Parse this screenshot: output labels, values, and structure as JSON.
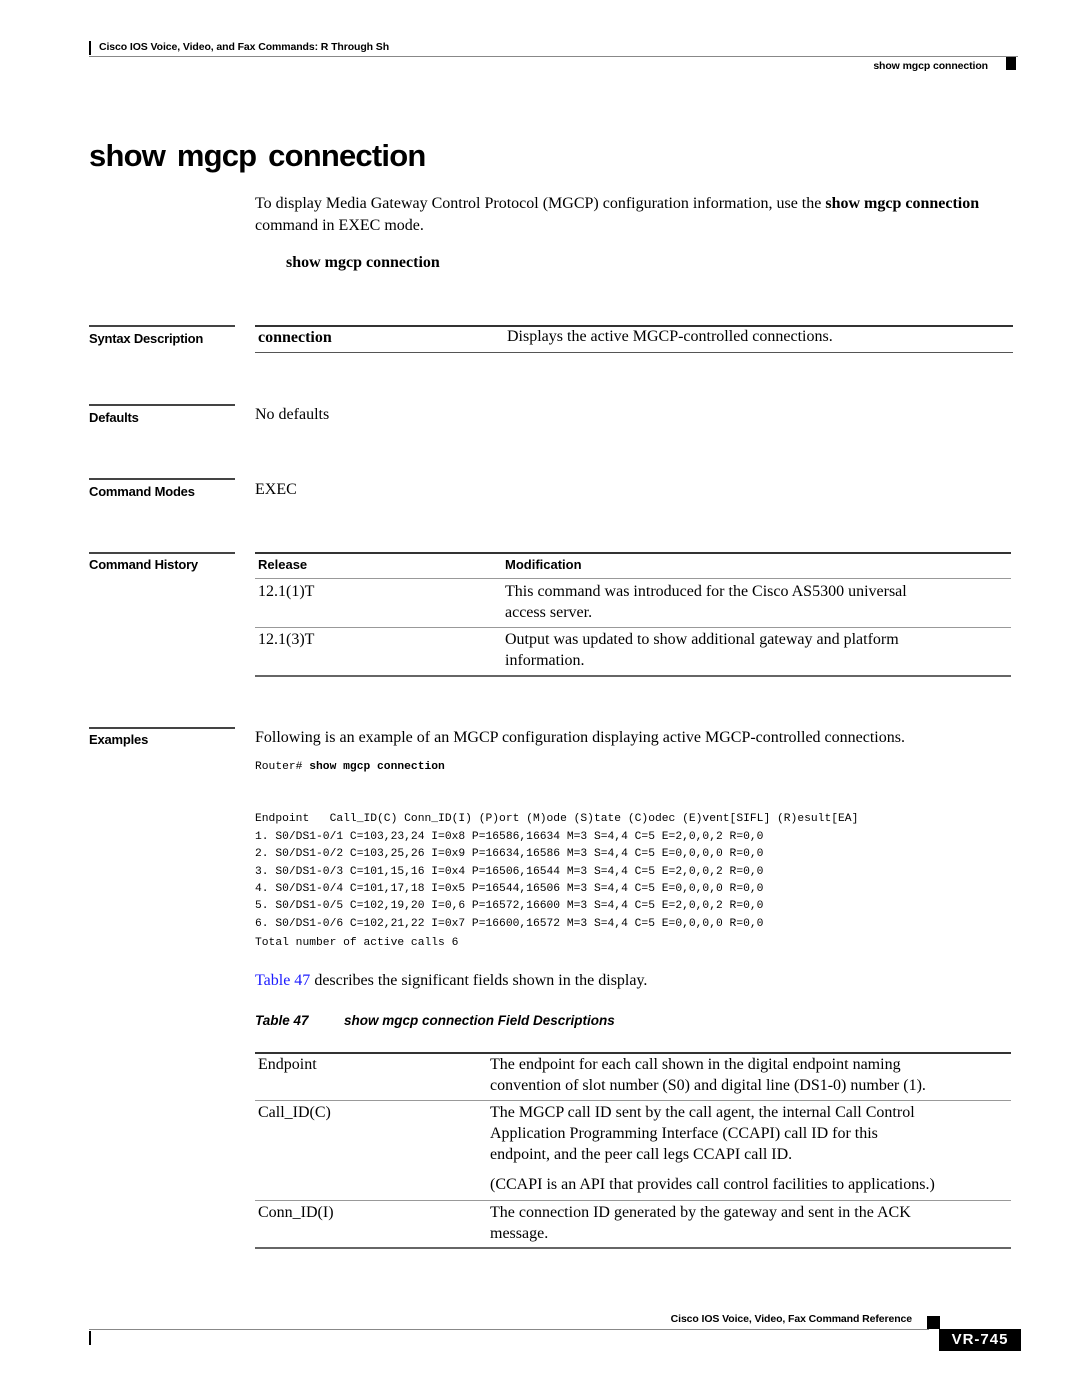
{
  "header": {
    "book_title": "Cisco IOS Voice, Video, and Fax Commands: R Through Sh",
    "running_head": "show mgcp connection"
  },
  "page_title": "show mgcp connection",
  "intro": {
    "text_before": "To display Media Gateway Control Protocol (MGCP) configuration information, use the ",
    "cmd_bold": "show mgcp connection",
    "text_after": " command in EXEC mode."
  },
  "syntax_command": "show mgcp connection",
  "sections": {
    "syntax_description": {
      "label": "Syntax Description",
      "rows": [
        {
          "keyword": "connection",
          "description": "Displays the active MGCP-controlled connections."
        }
      ]
    },
    "defaults": {
      "label": "Defaults",
      "value": "No defaults"
    },
    "command_modes": {
      "label": "Command Modes",
      "value": "EXEC"
    },
    "command_history": {
      "label": "Command History",
      "columns": [
        "Release",
        "Modification"
      ],
      "rows": [
        {
          "release": "12.1(1)T",
          "modification_line1": "This command was introduced for the Cisco AS5300 universal",
          "modification_line2": "access server."
        },
        {
          "release": "12.1(3)T",
          "modification_line1": "Output was updated to show additional gateway and platform",
          "modification_line2": "information."
        }
      ]
    },
    "examples": {
      "label": "Examples",
      "intro": "Following is an example of an MGCP configuration displaying active MGCP-controlled connections.",
      "prompt": "Router# ",
      "command": "show mgcp connection",
      "output_header": "Endpoint   Call_ID(C) Conn_ID(I) (P)ort (M)ode (S)tate (C)odec (E)vent[SIFL] (R)esult[EA]",
      "output_lines": [
        "1. S0/DS1-0/1 C=103,23,24 I=0x8 P=16586,16634 M=3 S=4,4 C=5 E=2,0,0,2 R=0,0",
        "2. S0/DS1-0/2 C=103,25,26 I=0x9 P=16634,16586 M=3 S=4,4 C=5 E=0,0,0,0 R=0,0",
        "3. S0/DS1-0/3 C=101,15,16 I=0x4 P=16506,16544 M=3 S=4,4 C=5 E=2,0,0,2 R=0,0",
        "4. S0/DS1-0/4 C=101,17,18 I=0x5 P=16544,16506 M=3 S=4,4 C=5 E=0,0,0,0 R=0,0",
        "5. S0/DS1-0/5 C=102,19,20 I=0,6 P=16572,16600 M=3 S=4,4 C=5 E=2,0,0,2 R=0,0",
        "6. S0/DS1-0/6 C=102,21,22 I=0x7 P=16600,16572 M=3 S=4,4 C=5 E=0,0,0,0 R=0,0"
      ],
      "total_line": "Total number of active calls 6",
      "table_ref_link": "Table 47",
      "table_ref_text": " describes the significant fields shown in the display."
    }
  },
  "field_table": {
    "caption_number": "Table 47",
    "caption_title": "show mgcp connection Field Descriptions",
    "rows": [
      {
        "field": "Endpoint",
        "lines": [
          "The endpoint for each call shown in the digital endpoint naming",
          "convention of slot number (S0) and digital line (DS1-0) number (1)."
        ]
      },
      {
        "field": "Call_ID(C)",
        "lines": [
          "The MGCP call ID sent by the call agent, the internal Call Control",
          "Application Programming Interface (CCAPI) call ID for this",
          "endpoint, and the peer call legs CCAPI call ID."
        ],
        "note": "(CCAPI is an API that provides call control facilities to applications.)"
      },
      {
        "field": "Conn_ID(I)",
        "lines": [
          "The connection ID generated by the gateway and sent in the ACK",
          "message."
        ]
      }
    ]
  },
  "footer": {
    "book_title": "Cisco IOS Voice, Video, Fax Command Reference",
    "page_number": "VR-745"
  },
  "colors": {
    "link": "#1a1aff",
    "text": "#000000",
    "page_tab_bg": "#000000"
  }
}
